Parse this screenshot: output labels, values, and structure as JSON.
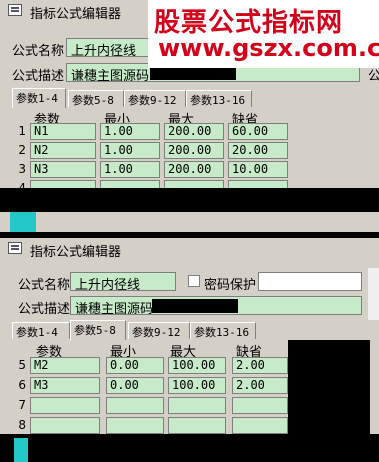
{
  "top": {
    "title": "指标公式编辑器",
    "name_label": "公式名称",
    "name_value": "上升内径线",
    "desc_label": "公式描述",
    "desc_value": "谦穗主图源码",
    "desc_label_right": "公",
    "tabs": [
      "参数1-4",
      "参数5-8",
      "参数9-12",
      "参数13-16"
    ],
    "active_tab": 0,
    "headers": [
      "参数",
      "最小",
      "最大",
      "缺省"
    ],
    "rows": [
      {
        "num": "1",
        "cells": [
          "N1",
          "1.00",
          "200.00",
          "60.00"
        ]
      },
      {
        "num": "2",
        "cells": [
          "N2",
          "1.00",
          "200.00",
          "20.00"
        ]
      },
      {
        "num": "3",
        "cells": [
          "N3",
          "1.00",
          "200.00",
          "10.00"
        ]
      },
      {
        "num": "4",
        "cells": [
          "",
          "",
          "",
          ""
        ]
      }
    ]
  },
  "watermark": {
    "text": "股票公式指标网",
    "url": "www.gszx.com.cn"
  },
  "bottom": {
    "title": "指标公式编辑器",
    "name_label": "公式名称",
    "name_value": "上升内径线",
    "password_label": "密码保护",
    "desc_label": "公式描述",
    "desc_value": "谦穗主图源码",
    "tabs": [
      "参数1-4",
      "参数5-8",
      "参数9-12",
      "参数13-16"
    ],
    "active_tab": 1,
    "headers": [
      "参数",
      "最小",
      "最大",
      "缺省"
    ],
    "rows": [
      {
        "num": "5",
        "cells": [
          "M2",
          "0.00",
          "100.00",
          "2.00"
        ]
      },
      {
        "num": "6",
        "cells": [
          "M3",
          "0.00",
          "100.00",
          "2.00"
        ]
      },
      {
        "num": "7",
        "cells": [
          "",
          "",
          "",
          ""
        ]
      },
      {
        "num": "8",
        "cells": [
          "",
          "",
          "",
          ""
        ]
      }
    ]
  },
  "colors": {
    "field_green": "#c7ebc9",
    "dialog_gray": "#d4d0c8",
    "watermark_red": "#d4001a"
  }
}
